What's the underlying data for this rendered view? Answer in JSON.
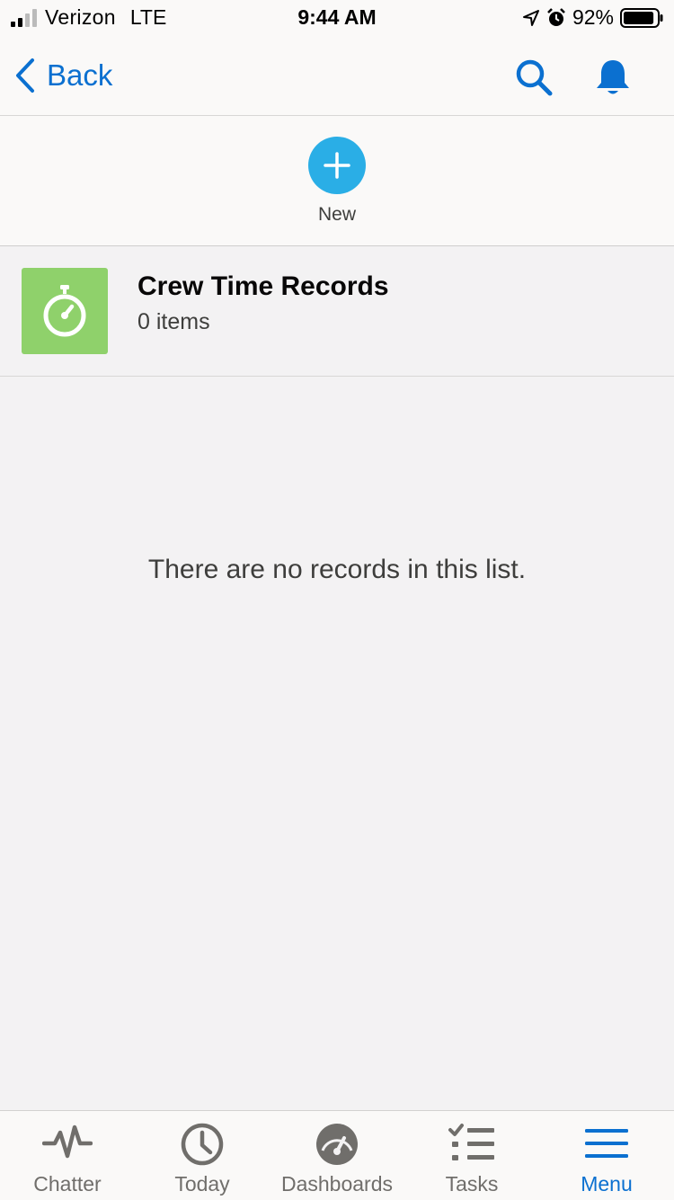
{
  "status_bar": {
    "carrier": "Verizon",
    "network": "LTE",
    "time": "9:44 AM",
    "battery_percent": "92%",
    "battery_level": 0.92
  },
  "nav": {
    "back_label": "Back",
    "icons": [
      "search-icon",
      "bell-icon"
    ],
    "accent_color": "#0b70d0"
  },
  "actions": {
    "new_label": "New",
    "new_color": "#2aaee6"
  },
  "list": {
    "title": "Crew Time Records",
    "count_label": "0 items",
    "icon": "stopwatch-icon",
    "icon_color": "#8fd16b",
    "empty_message": "There are no records in this list."
  },
  "tabs": [
    {
      "label": "Chatter",
      "icon": "activity-icon",
      "active": false
    },
    {
      "label": "Today",
      "icon": "clock-icon",
      "active": false
    },
    {
      "label": "Dashboards",
      "icon": "gauge-icon",
      "active": false
    },
    {
      "label": "Tasks",
      "icon": "checklist-icon",
      "active": false
    },
    {
      "label": "Menu",
      "icon": "menu-icon",
      "active": true
    }
  ]
}
